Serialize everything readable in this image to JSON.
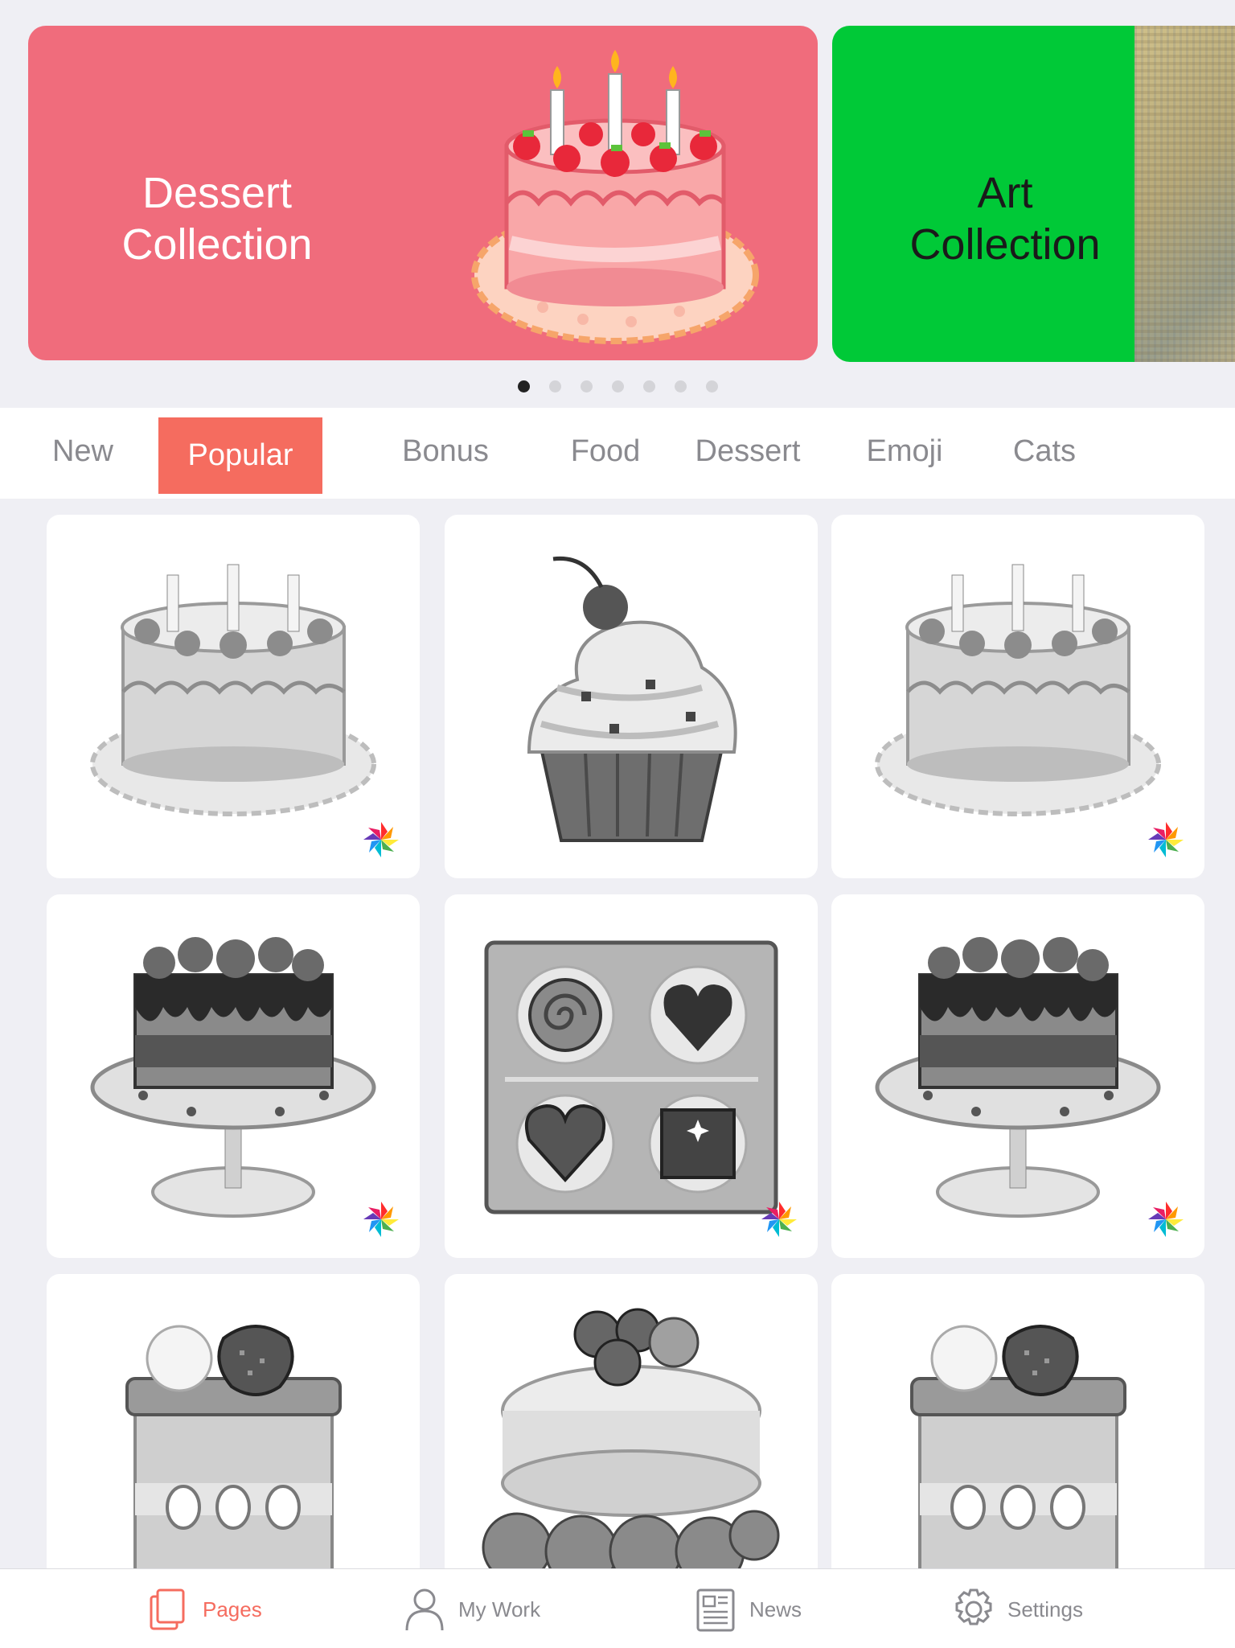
{
  "banners": [
    {
      "title": "Dessert Collection",
      "line1": "Dessert",
      "line2": "Collection",
      "color": "#f06c7c"
    },
    {
      "title": "Art Collection",
      "line1": "Art",
      "line2": "Collection",
      "color": "#00c937"
    }
  ],
  "page_indicator": {
    "count": 7,
    "active_index": 0
  },
  "categories": {
    "active": "Popular",
    "items": [
      "New",
      "Popular",
      "Bonus",
      "Food",
      "Dessert",
      "Emoji",
      "Cats"
    ]
  },
  "gallery": {
    "items": [
      {
        "subject": "birthday-cake",
        "badge": true
      },
      {
        "subject": "cupcake",
        "badge": false
      },
      {
        "subject": "birthday-cake",
        "badge": true
      },
      {
        "subject": "chocolate-drip-cake",
        "badge": true
      },
      {
        "subject": "chocolate-box",
        "badge": true
      },
      {
        "subject": "chocolate-drip-cake",
        "badge": true
      },
      {
        "subject": "strawberry-shortcake",
        "badge": false
      },
      {
        "subject": "berry-tart",
        "badge": false
      },
      {
        "subject": "strawberry-shortcake",
        "badge": false
      }
    ]
  },
  "tabbar": {
    "active": "Pages",
    "items": [
      {
        "label": "Pages",
        "icon": "pages-icon"
      },
      {
        "label": "My Work",
        "icon": "person-icon"
      },
      {
        "label": "News",
        "icon": "newspaper-icon"
      },
      {
        "label": "Settings",
        "icon": "gear-icon"
      }
    ]
  },
  "colors": {
    "accent": "#f56c5f",
    "dessert_banner": "#f06c7c",
    "art_banner": "#00c937"
  }
}
